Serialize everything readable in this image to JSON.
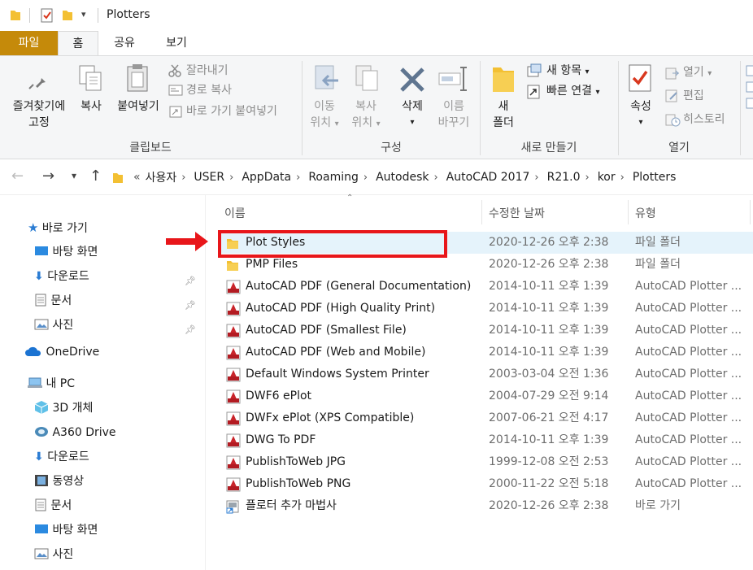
{
  "window": {
    "title": "Plotters"
  },
  "tabs": [
    {
      "label": "파일"
    },
    {
      "label": "홈"
    },
    {
      "label": "공유"
    },
    {
      "label": "보기"
    }
  ],
  "ribbon": {
    "clipboard": {
      "pin": {
        "line1": "즐겨찾기에",
        "line2": "고정"
      },
      "copy": "복사",
      "paste": "붙여넣기",
      "cut": "잘라내기",
      "copy_path": "경로 복사",
      "paste_shortcut": "바로 가기 붙여넣기",
      "label": "클립보드"
    },
    "organize": {
      "move": {
        "line1": "이동",
        "line2": "위치"
      },
      "copy_to": {
        "line1": "복사",
        "line2": "위치"
      },
      "delete": "삭제",
      "rename": {
        "line1": "이름",
        "line2": "바꾸기"
      },
      "label": "구성"
    },
    "new": {
      "new_folder": {
        "line1": "새",
        "line2": "폴더"
      },
      "new_item": "새 항목",
      "easy_access": "빠른 연결",
      "label": "새로 만들기"
    },
    "open": {
      "properties": "속성",
      "open": "열기",
      "edit": "편집",
      "history": "히스토리",
      "label": "열기"
    }
  },
  "address": {
    "prefix": "«",
    "crumbs": [
      "사용자",
      "USER",
      "AppData",
      "Roaming",
      "Autodesk",
      "AutoCAD 2017",
      "R21.0",
      "kor",
      "Plotters"
    ]
  },
  "sidebar": {
    "quick_access": "바로 가기",
    "items_quick": [
      {
        "label": "바탕 화면",
        "icon": "desktop-icon"
      },
      {
        "label": "다운로드",
        "icon": "download-icon"
      },
      {
        "label": "문서",
        "icon": "document-icon"
      },
      {
        "label": "사진",
        "icon": "picture-icon"
      }
    ],
    "onedrive": "OneDrive",
    "this_pc": "내 PC",
    "items_pc": [
      {
        "label": "3D 개체",
        "icon": "3d-objects-icon"
      },
      {
        "label": "A360 Drive",
        "icon": "a360-icon"
      },
      {
        "label": "다운로드",
        "icon": "download-icon"
      },
      {
        "label": "동영상",
        "icon": "video-icon"
      },
      {
        "label": "문서",
        "icon": "document-icon"
      },
      {
        "label": "바탕 화면",
        "icon": "desktop-icon"
      },
      {
        "label": "사진",
        "icon": "picture-icon"
      }
    ]
  },
  "columns": {
    "name": "이름",
    "date": "수정한 날짜",
    "type": "유형"
  },
  "files": [
    {
      "name": "Plot Styles",
      "date": "2020-12-26 오후 2:38",
      "type": "파일 폴더",
      "icon": "folder-icon",
      "selected": true
    },
    {
      "name": "PMP Files",
      "date": "2020-12-26 오후 2:38",
      "type": "파일 폴더",
      "icon": "folder-icon"
    },
    {
      "name": "AutoCAD PDF (General Documentation)",
      "date": "2014-10-11 오후 1:39",
      "type": "AutoCAD Plotter ...",
      "icon": "plotter-icon"
    },
    {
      "name": "AutoCAD PDF (High Quality Print)",
      "date": "2014-10-11 오후 1:39",
      "type": "AutoCAD Plotter ...",
      "icon": "plotter-icon"
    },
    {
      "name": "AutoCAD PDF (Smallest File)",
      "date": "2014-10-11 오후 1:39",
      "type": "AutoCAD Plotter ...",
      "icon": "plotter-icon"
    },
    {
      "name": "AutoCAD PDF (Web and Mobile)",
      "date": "2014-10-11 오후 1:39",
      "type": "AutoCAD Plotter ...",
      "icon": "plotter-icon"
    },
    {
      "name": "Default Windows System Printer",
      "date": "2003-03-04 오전 1:36",
      "type": "AutoCAD Plotter ...",
      "icon": "plotter-icon"
    },
    {
      "name": "DWF6 ePlot",
      "date": "2004-07-29 오전 9:14",
      "type": "AutoCAD Plotter ...",
      "icon": "plotter-icon"
    },
    {
      "name": "DWFx ePlot (XPS Compatible)",
      "date": "2007-06-21 오전 4:17",
      "type": "AutoCAD Plotter ...",
      "icon": "plotter-icon"
    },
    {
      "name": "DWG To PDF",
      "date": "2014-10-11 오후 1:39",
      "type": "AutoCAD Plotter ...",
      "icon": "plotter-icon"
    },
    {
      "name": "PublishToWeb JPG",
      "date": "1999-12-08 오전 2:53",
      "type": "AutoCAD Plotter ...",
      "icon": "plotter-icon"
    },
    {
      "name": "PublishToWeb PNG",
      "date": "2000-11-22 오전 5:18",
      "type": "AutoCAD Plotter ...",
      "icon": "plotter-icon"
    },
    {
      "name": "플로터 추가 마법사",
      "date": "2020-12-26 오후 2:38",
      "type": "바로 가기",
      "icon": "shortcut-wizard-icon"
    }
  ],
  "colors": {
    "file_tab": "#c58a0a",
    "highlight": "#e8161a",
    "selection": "#e5f3fb"
  }
}
